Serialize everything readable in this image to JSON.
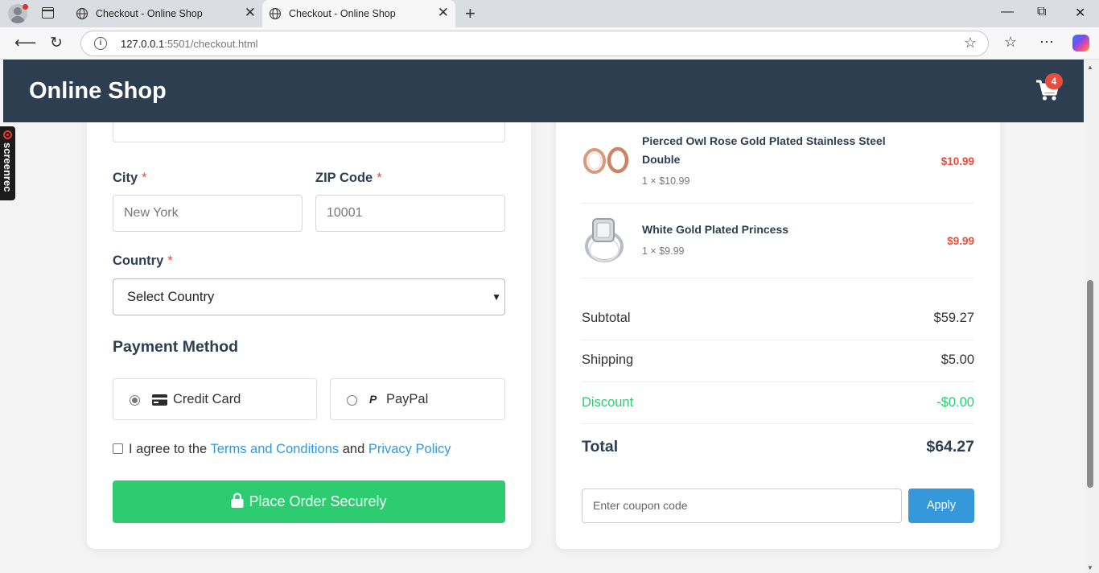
{
  "browser": {
    "tabs": [
      {
        "title": "Checkout - Online Shop"
      },
      {
        "title": "Checkout - Online Shop"
      }
    ],
    "url_host": "127.0.0.1",
    "url_path": ":5501/checkout.html"
  },
  "header": {
    "logo": "Online Shop",
    "cart_count": "4"
  },
  "screenrec": {
    "label": "screenrec"
  },
  "form": {
    "city": {
      "label": "City",
      "required": "*",
      "placeholder": "New York"
    },
    "zip": {
      "label": "ZIP Code",
      "required": "*",
      "placeholder": "10001"
    },
    "country": {
      "label": "Country",
      "required": "*",
      "selected": "Select Country"
    },
    "payment": {
      "title": "Payment Method",
      "options": [
        {
          "label": "Credit Card",
          "selected": true,
          "icon": "credit-card-icon"
        },
        {
          "label": "PayPal",
          "selected": false,
          "icon": "paypal-icon"
        }
      ]
    },
    "agree": {
      "prefix": "I agree to the",
      "terms": "Terms and Conditions",
      "middle": "and",
      "privacy": "Privacy Policy"
    },
    "submit": "Place Order Securely"
  },
  "summary": {
    "items": [
      {
        "name": "Pierced Owl Rose Gold Plated Stainless Steel Double",
        "qty": "1 × $10.99",
        "price": "$10.99"
      },
      {
        "name": "White Gold Plated Princess",
        "qty": "1 × $9.99",
        "price": "$9.99"
      }
    ],
    "subtotal": {
      "label": "Subtotal",
      "value": "$59.27"
    },
    "shipping": {
      "label": "Shipping",
      "value": "$5.00"
    },
    "discount": {
      "label": "Discount",
      "value": "-$0.00"
    },
    "total": {
      "label": "Total",
      "value": "$64.27"
    },
    "coupon_placeholder": "Enter coupon code",
    "apply": "Apply"
  },
  "colors": {
    "header": "#2c3e50",
    "accent_green": "#2ecc71",
    "accent_blue": "#3498db",
    "price_red": "#e74c3c"
  }
}
